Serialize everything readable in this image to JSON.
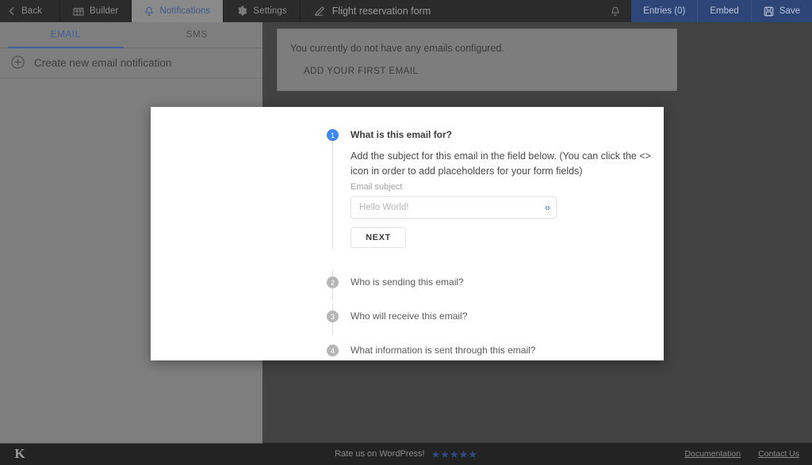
{
  "topbar": {
    "back_label": "Back",
    "builder_label": "Builder",
    "notifications_label": "Notifications",
    "settings_label": "Settings",
    "form_title": "Flight reservation form",
    "entries_label": "Entries (0)",
    "embed_label": "Embed",
    "save_label": "Save",
    "accent_blue": "#2d4677",
    "active_tab_text": "#3f5b8c"
  },
  "sidebar": {
    "tabs": [
      {
        "label": "EMAIL",
        "active": true
      },
      {
        "label": "SMS",
        "active": false
      }
    ],
    "create_label": "Create new email notification"
  },
  "main": {
    "empty_message": "You currently do not have any emails configured.",
    "empty_action": "ADD YOUR FIRST EMAIL"
  },
  "modal": {
    "steps": [
      {
        "number": "1",
        "title": "What is this email for?",
        "active": true,
        "description": "Add the subject for this email in the field below. (You can click the <> icon in order to add placeholders for your form fields)",
        "field_label": "Email subject",
        "field_value": "",
        "field_placeholder": "Hello World!",
        "code_icon": "‹›",
        "next_label": "NEXT"
      },
      {
        "number": "2",
        "title": "Who is sending this email?",
        "active": false
      },
      {
        "number": "3",
        "title": "Who will receive this email?",
        "active": false
      },
      {
        "number": "4",
        "title": "What information is sent through this email?",
        "active": false
      }
    ],
    "active_bullet_color": "#4285f4",
    "inactive_bullet_color": "#b6b6b6"
  },
  "footer": {
    "logo": "K",
    "rate_label": "Rate us on WordPress!",
    "stars": "★★★★★",
    "star_color": "#2f4c80",
    "documentation_label": "Documentation",
    "contact_label": "Contact Us"
  }
}
